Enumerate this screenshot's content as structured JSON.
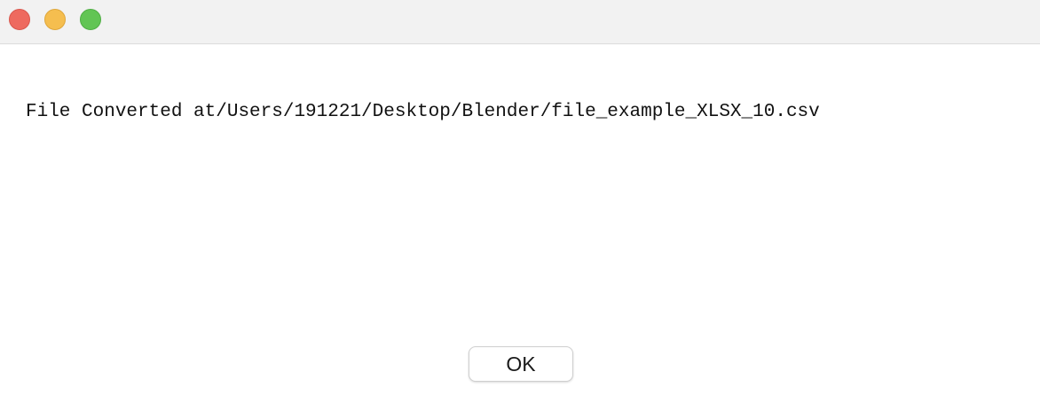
{
  "window": {
    "controls": {
      "close_icon": "close-icon",
      "minimize_icon": "minimize-icon",
      "zoom_icon": "zoom-icon",
      "colors": {
        "close": "#ee6a5f",
        "minimize": "#f5be4f",
        "zoom": "#62c554"
      }
    }
  },
  "dialog": {
    "message": "File Converted at/Users/191221/Desktop/Blender/file_example_XLSX_10.csv",
    "ok_label": "OK"
  }
}
